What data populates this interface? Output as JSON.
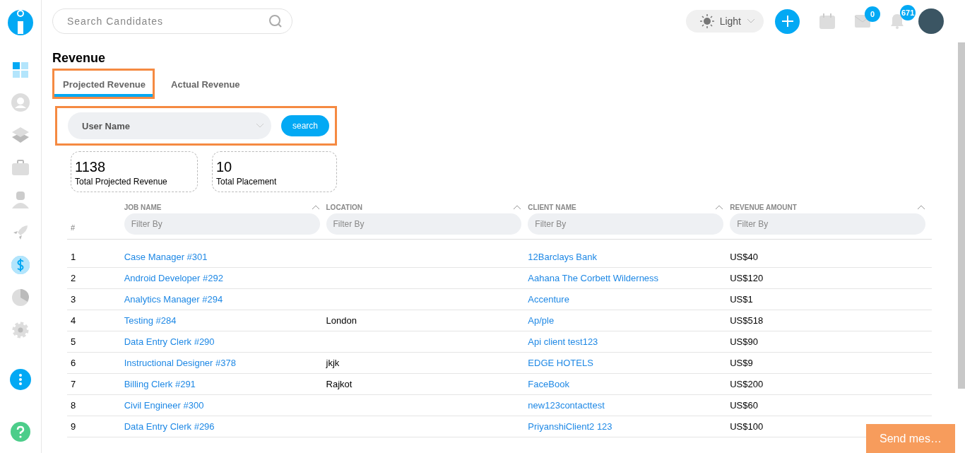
{
  "sidebar": {
    "items": [
      {
        "kind": "dashboard",
        "selected": false
      },
      {
        "kind": "user",
        "selected": false
      },
      {
        "kind": "layers",
        "selected": false
      },
      {
        "kind": "briefcase",
        "selected": false
      },
      {
        "kind": "person",
        "selected": false
      },
      {
        "kind": "rocket",
        "selected": false
      },
      {
        "kind": "dollar",
        "selected": true
      },
      {
        "kind": "pie",
        "selected": false
      },
      {
        "kind": "gear",
        "selected": false
      }
    ]
  },
  "topbar": {
    "search": {
      "placeholder": "Search Candidates"
    },
    "theme": "Light",
    "mail_badge": "0",
    "bell_badge": "671"
  },
  "page_title": "Revenue",
  "tabs": [
    {
      "label": "Projected Revenue",
      "selected": true
    },
    {
      "label": "Actual Revenue",
      "selected": false
    }
  ],
  "filter": {
    "placeholder": "User Name",
    "button": "search"
  },
  "stats": [
    {
      "value": "1138",
      "label": "Total Projected Revenue"
    },
    {
      "value": "10",
      "label": "Total Placement"
    }
  ],
  "table": {
    "index_header": "#",
    "columns": [
      {
        "label": "JOB NAME",
        "placeholder": "Filter By"
      },
      {
        "label": "LOCATION",
        "placeholder": "Filter By"
      },
      {
        "label": "CLIENT NAME",
        "placeholder": "Filter By"
      },
      {
        "label": "REVENUE AMOUNT",
        "placeholder": "Filter By"
      }
    ],
    "rows": [
      {
        "index": "1",
        "job": "Case Manager #301",
        "location": "",
        "client": "12Barclays Bank",
        "amount": "US$40"
      },
      {
        "index": "2",
        "job": "Android Developer #292",
        "location": "",
        "client": "Aahana The Corbett Wilderness",
        "amount": "US$120"
      },
      {
        "index": "3",
        "job": "Analytics Manager #294",
        "location": "",
        "client": "Accenture",
        "amount": "US$1"
      },
      {
        "index": "4",
        "job": "Testing #284",
        "location": "London",
        "client": "Ap/ple",
        "amount": "US$518"
      },
      {
        "index": "5",
        "job": "Data Entry Clerk #290",
        "location": "",
        "client": "Api client test123",
        "amount": "US$90"
      },
      {
        "index": "6",
        "job": "Instructional Designer #378",
        "location": "jkjk",
        "client": "EDGE HOTELS",
        "amount": "US$9"
      },
      {
        "index": "7",
        "job": "Billing Clerk #291",
        "location": "Rajkot",
        "client": "FaceBook",
        "amount": "US$200"
      },
      {
        "index": "8",
        "job": "Civil Engineer #300",
        "location": "",
        "client": "new123contacttest",
        "amount": "US$60"
      },
      {
        "index": "9",
        "job": "Data Entry Clerk #296",
        "location": "",
        "client": "PriyanshiClient2 123",
        "amount": "US$100"
      }
    ]
  },
  "chat_button": "Send mes…"
}
